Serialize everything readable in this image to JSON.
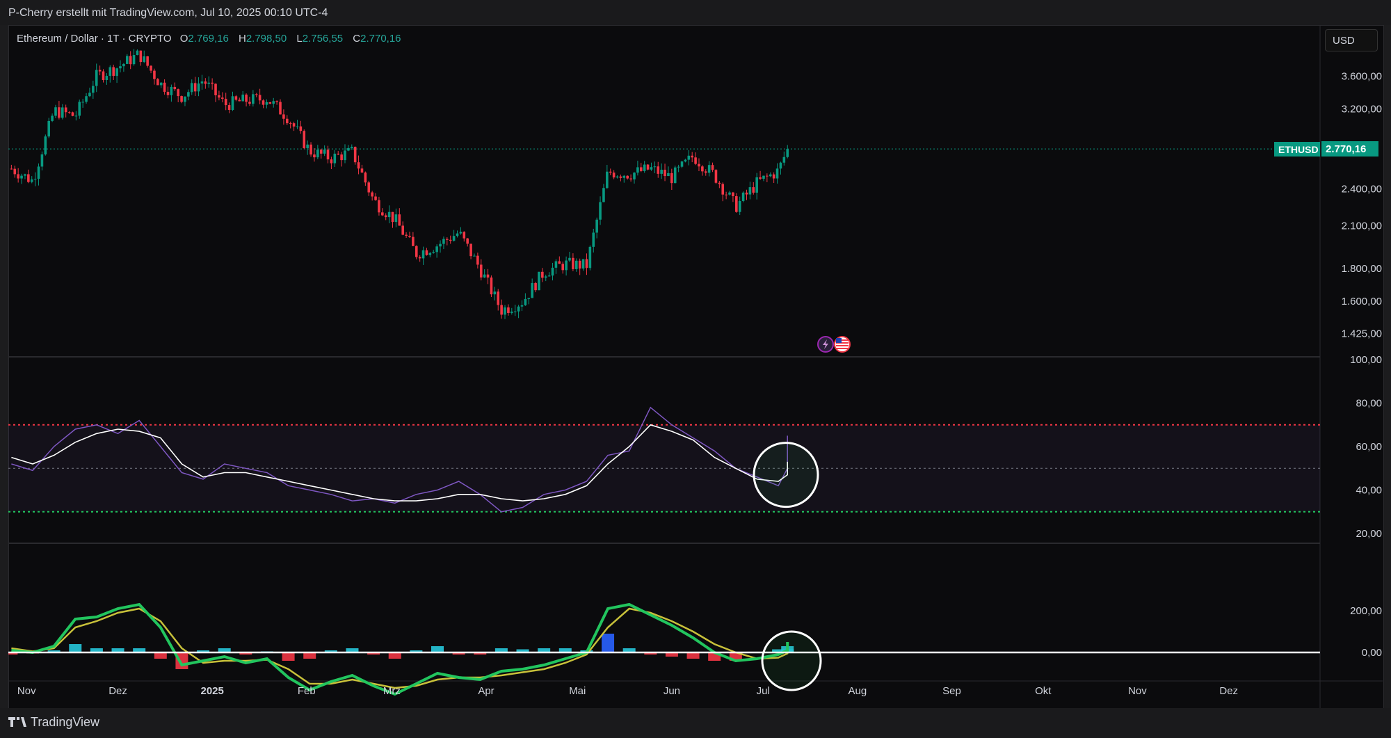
{
  "header": {
    "attribution": "P-Cherry erstellt mit TradingView.com, Jul 10, 2025 00:10 UTC-4"
  },
  "symbol": {
    "name": "Ethereum / Dollar · 1T · CRYPTO",
    "o_label": "O",
    "o": "2.769,16",
    "h_label": "H",
    "h": "2.798,50",
    "l_label": "L",
    "l": "2.756,55",
    "c_label": "C",
    "c": "2.770,16"
  },
  "currency_button": "USD",
  "last_price": {
    "ticker": "ETHUSD",
    "value": "2.770,16"
  },
  "footer": {
    "brand": "TradingView"
  },
  "colors": {
    "up": "#089981",
    "down": "#f23645",
    "rsi": "#7e57c2",
    "accent": "#089981"
  },
  "icons": [
    "lightning-icon",
    "us-flag-icon"
  ],
  "chart_data": [
    {
      "type": "candlestick",
      "title": "Ethereum / Dollar · 1T · CRYPTO",
      "y_scale": "log",
      "ylim": [
        1350,
        4200
      ],
      "y_ticks": [
        "3.600,00",
        "3.200,00",
        "2.400,00",
        "2.100,00",
        "1.800,00",
        "1.600,00",
        "1.425,00"
      ],
      "y_tick_values": [
        3600,
        3200,
        2400,
        2100,
        1800,
        1600,
        1425
      ],
      "x_ticks": [
        "Nov",
        "Dez",
        "2025",
        "Feb",
        "Mrz",
        "Apr",
        "Mai",
        "Jun",
        "Jul",
        "Aug",
        "Sep",
        "Okt",
        "Nov",
        "Dez"
      ],
      "last_close": 2770.16,
      "close_path": [
        {
          "date": "2024-10-27",
          "close": 2580
        },
        {
          "date": "2024-11-03",
          "close": 2470
        },
        {
          "date": "2024-11-10",
          "close": 3180
        },
        {
          "date": "2024-11-17",
          "close": 3120
        },
        {
          "date": "2024-11-24",
          "close": 3600
        },
        {
          "date": "2024-12-01",
          "close": 3720
        },
        {
          "date": "2024-12-08",
          "close": 3900
        },
        {
          "date": "2024-12-15",
          "close": 3500
        },
        {
          "date": "2024-12-22",
          "close": 3350
        },
        {
          "date": "2024-12-29",
          "close": 3550
        },
        {
          "date": "2025-01-05",
          "close": 3250
        },
        {
          "date": "2025-01-12",
          "close": 3300
        },
        {
          "date": "2025-01-19",
          "close": 3320
        },
        {
          "date": "2025-01-26",
          "close": 3100
        },
        {
          "date": "2025-02-02",
          "close": 2750
        },
        {
          "date": "2025-02-09",
          "close": 2680
        },
        {
          "date": "2025-02-16",
          "close": 2740
        },
        {
          "date": "2025-02-23",
          "close": 2300
        },
        {
          "date": "2025-03-02",
          "close": 2150
        },
        {
          "date": "2025-03-09",
          "close": 1900
        },
        {
          "date": "2025-03-16",
          "close": 1960
        },
        {
          "date": "2025-03-23",
          "close": 2050
        },
        {
          "date": "2025-03-30",
          "close": 1800
        },
        {
          "date": "2025-04-06",
          "close": 1550
        },
        {
          "date": "2025-04-13",
          "close": 1600
        },
        {
          "date": "2025-04-20",
          "close": 1780
        },
        {
          "date": "2025-04-27",
          "close": 1830
        },
        {
          "date": "2025-05-04",
          "close": 1820
        },
        {
          "date": "2025-05-11",
          "close": 2550
        },
        {
          "date": "2025-05-18",
          "close": 2530
        },
        {
          "date": "2025-05-25",
          "close": 2580
        },
        {
          "date": "2025-06-01",
          "close": 2500
        },
        {
          "date": "2025-06-08",
          "close": 2700
        },
        {
          "date": "2025-06-15",
          "close": 2520
        },
        {
          "date": "2025-06-22",
          "close": 2250
        },
        {
          "date": "2025-06-29",
          "close": 2450
        },
        {
          "date": "2025-07-06",
          "close": 2560
        },
        {
          "date": "2025-07-09",
          "close": 2770
        }
      ]
    },
    {
      "type": "line",
      "ylim": [
        20,
        100
      ],
      "y_ticks": [
        "100,00",
        "80,00",
        "60,00",
        "40,00",
        "20,00"
      ],
      "y_tick_values": [
        100,
        80,
        60,
        40,
        20
      ],
      "overbought": 70,
      "midline": 50,
      "oversold": 30,
      "series": [
        {
          "values": [
            52,
            49,
            60,
            68,
            70,
            66,
            72,
            60,
            48,
            45,
            52,
            50,
            48,
            42,
            40,
            38,
            35,
            36,
            34,
            38,
            40,
            44,
            38,
            30,
            32,
            38,
            40,
            44,
            56,
            58,
            78,
            70,
            64,
            58,
            50,
            46,
            42,
            50,
            65
          ]
        },
        {
          "values": [
            55,
            52,
            56,
            62,
            66,
            68,
            67,
            64,
            52,
            46,
            48,
            48,
            46,
            44,
            42,
            40,
            38,
            36,
            35,
            35,
            36,
            38,
            38,
            36,
            35,
            36,
            38,
            42,
            52,
            60,
            70,
            67,
            63,
            55,
            50,
            45,
            44,
            47,
            53
          ]
        }
      ]
    },
    {
      "type": "line",
      "y_ticks": [
        "200,00",
        "0,00"
      ],
      "y_tick_values": [
        200,
        0
      ],
      "series": [
        {
          "values": [
            10,
            0,
            30,
            160,
            170,
            210,
            230,
            120,
            -60,
            -40,
            -20,
            -50,
            -30,
            -120,
            -180,
            -140,
            -110,
            -160,
            -200,
            -150,
            -100,
            -120,
            -130,
            -90,
            -80,
            -60,
            -30,
            0,
            210,
            230,
            180,
            130,
            70,
            0,
            -40,
            -30,
            -10,
            10,
            50
          ]
        },
        {
          "values": [
            20,
            5,
            20,
            120,
            150,
            190,
            210,
            150,
            20,
            -50,
            -40,
            -40,
            -35,
            -80,
            -150,
            -150,
            -130,
            -150,
            -170,
            -160,
            -130,
            -120,
            -120,
            -110,
            -95,
            -80,
            -50,
            -10,
            120,
            210,
            190,
            150,
            100,
            40,
            0,
            -30,
            -25,
            -5,
            20
          ]
        },
        {
          "values": [
            -10,
            -5,
            10,
            40,
            20,
            20,
            20,
            -30,
            -80,
            10,
            20,
            -10,
            5,
            -40,
            -30,
            10,
            20,
            -10,
            -30,
            10,
            30,
            -10,
            -10,
            20,
            15,
            20,
            20,
            10,
            90,
            20,
            -10,
            -20,
            -30,
            -40,
            -40,
            0,
            15,
            15,
            30
          ]
        }
      ]
    }
  ]
}
